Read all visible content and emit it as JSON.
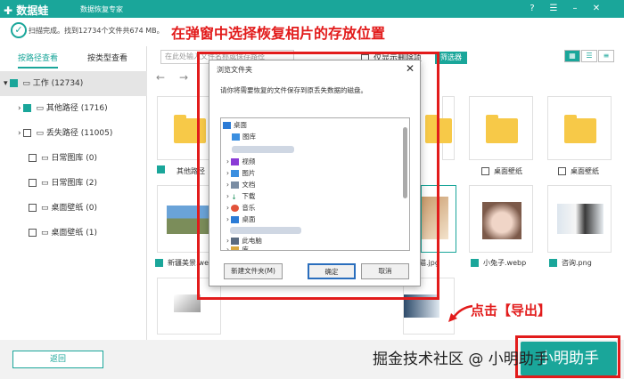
{
  "app": {
    "title": "数据蛙",
    "subtitle": "数据恢复专家"
  },
  "status": {
    "text": "扫描完成。找到12734个文件共674 MB。"
  },
  "annotations": {
    "top": "在弹窗中选择恢复相片的存放位置",
    "export_hint": "点击【导出】",
    "watermark": "掘金技术社区 @ 小明助手"
  },
  "tabs": [
    "按路径查看",
    "按类型查看"
  ],
  "tree": [
    {
      "label": "工作 (12734)"
    },
    {
      "label": "其他路径 (1716)"
    },
    {
      "label": "丢失路径 (11005)"
    },
    {
      "label": "日常图库 (0)"
    },
    {
      "label": "日常图库 (2)"
    },
    {
      "label": "桌面壁纸 (0)"
    },
    {
      "label": "桌面壁纸 (1)"
    }
  ],
  "toolbar": {
    "search_placeholder": "在此处输入文件名称或保存路径",
    "filter": "筛选器",
    "only_deleted": "仅显示删除项"
  },
  "grid": {
    "row1": [
      "其他路径",
      "",
      "",
      "桌面壁纸",
      "桌面壁纸"
    ],
    "row2": [
      "新疆美景.webp",
      "",
      "猫.jpg",
      "小兔子.webp",
      "咨询.png"
    ]
  },
  "dialog": {
    "title": "浏览文件夹",
    "message": "请你将需要恢复的文件保存到原丢失数据的磁盘。",
    "nodes": [
      "桌面",
      "图库",
      "视频",
      "图片",
      "文档",
      "下载",
      "音乐",
      "桌面",
      "此电脑",
      "库"
    ],
    "new_folder": "新建文件夹(M)",
    "ok": "确定",
    "cancel": "取消"
  },
  "footer": {
    "back": "返回",
    "export": "小明助手"
  },
  "colors": {
    "accent": "#1aa69a",
    "annotation": "#e21b1b"
  }
}
